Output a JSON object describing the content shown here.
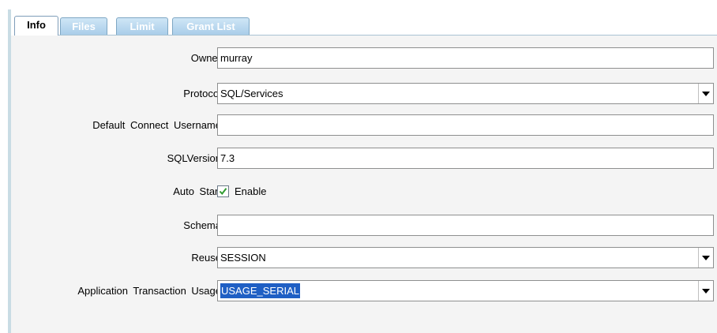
{
  "tabs": [
    {
      "label": "Info",
      "active": true
    },
    {
      "label": "Files",
      "active": false
    },
    {
      "label": "Limit",
      "active": false
    },
    {
      "label": "Grant List",
      "active": false
    }
  ],
  "form": {
    "owner": {
      "label": "Owner",
      "value": "murray"
    },
    "protocol": {
      "label": "Protocol",
      "value": "SQL/Services"
    },
    "default_connect_username": {
      "label": "Default Connect Username",
      "value": ""
    },
    "sql_version": {
      "label": "SQLVersion",
      "value": "7.3"
    },
    "auto_start": {
      "label": "Auto Start",
      "checkbox_label": "Enable",
      "checked": true
    },
    "schema": {
      "label": "Schema",
      "value": ""
    },
    "reuse": {
      "label": "Reuse",
      "value": "SESSION"
    },
    "application_transaction_usage": {
      "label": "Application Transaction Usage",
      "value": "USAGE_SERIAL"
    }
  },
  "icons": {
    "checkmark": "check-icon",
    "dropdown": "chevron-down-icon"
  },
  "colors": {
    "tab_inactive": "#a9cde9",
    "selection": "#1f5fc4",
    "checkmark": "#2f9b2f"
  }
}
